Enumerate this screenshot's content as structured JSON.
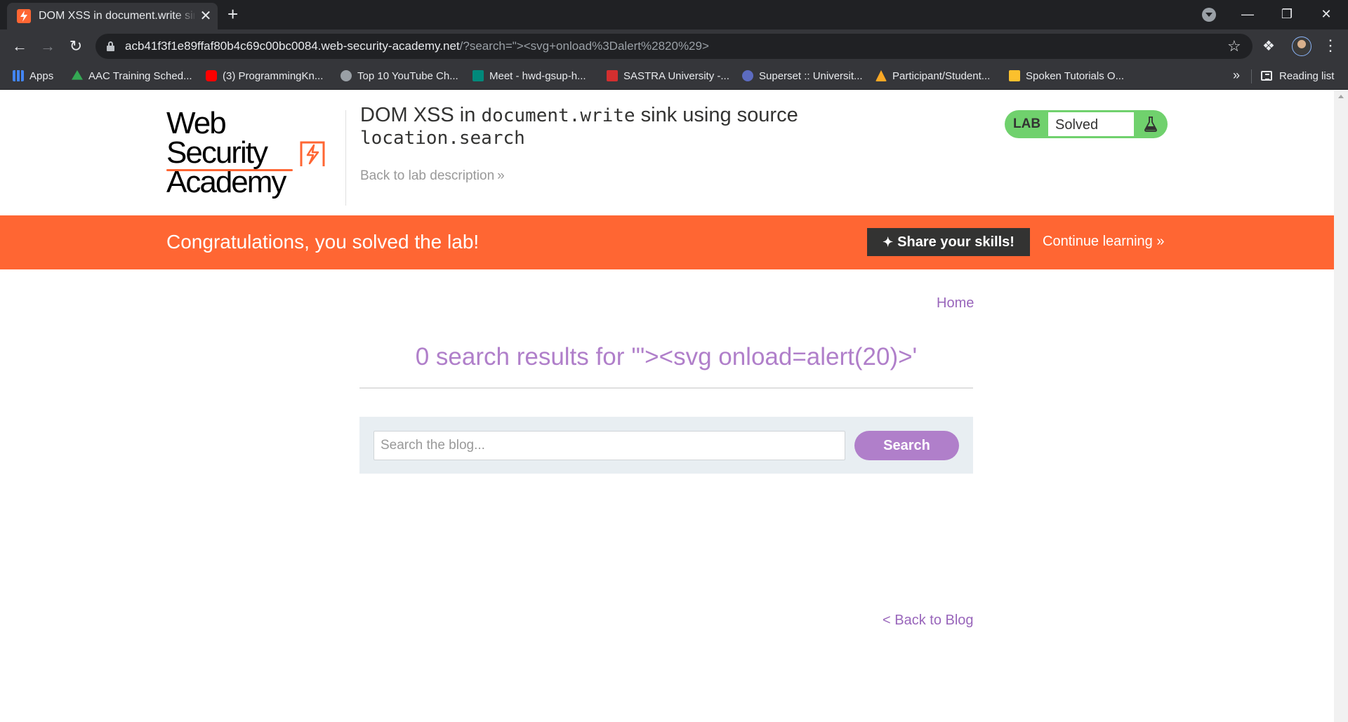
{
  "browser": {
    "tab_title": "DOM XSS in document.write sink using source location.search",
    "new_tab": "+",
    "close": "✕",
    "url_host": "acb41f3f1e89ffaf80b4c69c00bc0084.web-security-academy.net",
    "url_rest": "/?search=\"><svg+onload%3Dalert%2820%29>",
    "bookmarks": [
      {
        "label": "Apps",
        "color": "#4285f4"
      },
      {
        "label": "AAC Training Sched...",
        "color": "#34a853"
      },
      {
        "label": "(3) ProgrammingKn...",
        "color": "#ff0000"
      },
      {
        "label": "Top 10 YouTube Ch...",
        "color": "#9aa0a6"
      },
      {
        "label": "Meet - hwd-gsup-h...",
        "color": "#00897b"
      },
      {
        "label": "SASTRA University -...",
        "color": "#d32f2f"
      },
      {
        "label": "Superset :: Universit...",
        "color": "#5c6bc0"
      },
      {
        "label": "Participant/Student...",
        "color": "#f9a825"
      },
      {
        "label": "Spoken Tutorials O...",
        "color": "#fbc02d"
      }
    ],
    "more": "»",
    "reading_list": "Reading list"
  },
  "header": {
    "logo_line1": "Web Security",
    "logo_line2": "Academy",
    "title_part1": "DOM XSS in ",
    "title_code1": "document.write",
    "title_part2": " sink using source ",
    "title_code2": "location.search",
    "back_to_description": "Back to lab description",
    "chevron": "»",
    "lab_label": "LAB",
    "lab_status": "Solved"
  },
  "banner": {
    "message": "Congratulations, you solved the lab!",
    "share": "Share your skills!",
    "continue": "Continue learning",
    "chevron": "»"
  },
  "main": {
    "home": "Home",
    "results_heading": "0 search results for '\"><svg onload=alert(20)>'",
    "search_placeholder": "Search the blog...",
    "search_button": "Search",
    "back_to_blog": "< Back to Blog"
  },
  "colors": {
    "brand_orange": "#ff6633",
    "solved_green": "#70d16d",
    "link_purple": "#9966bb",
    "heading_purple": "#b07fca"
  }
}
